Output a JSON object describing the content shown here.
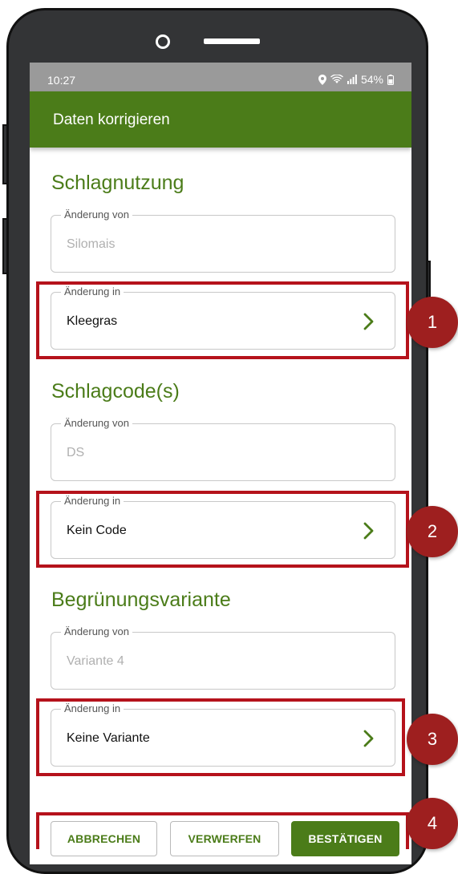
{
  "status_bar": {
    "time": "10:27",
    "battery": "54%"
  },
  "app_bar": {
    "title": "Daten korrigieren"
  },
  "sections": [
    {
      "title": "Schlagnutzung",
      "from": {
        "label": "Änderung von",
        "value": "Silomais"
      },
      "to": {
        "label": "Änderung in",
        "value": "Kleegras"
      }
    },
    {
      "title": "Schlagcode(s)",
      "from": {
        "label": "Änderung von",
        "value": "DS"
      },
      "to": {
        "label": "Änderung in",
        "value": "Kein Code"
      }
    },
    {
      "title": "Begrünungsvariante",
      "from": {
        "label": "Änderung von",
        "value": "Variante 4"
      },
      "to": {
        "label": "Änderung in",
        "value": "Keine Variante"
      }
    }
  ],
  "buttons": {
    "cancel": "ABBRECHEN",
    "discard": "VERWERFEN",
    "confirm": "BESTÄTIGEN"
  },
  "callouts": [
    "1",
    "2",
    "3",
    "4"
  ],
  "colors": {
    "primary_green": "#4b7c19",
    "highlight_red": "#b5121b",
    "badge_red": "#9e1f1f"
  },
  "icons": {
    "field_action": "chevron-right-icon",
    "status": [
      "location-icon",
      "wifi-icon",
      "signal-icon",
      "battery-icon"
    ]
  }
}
